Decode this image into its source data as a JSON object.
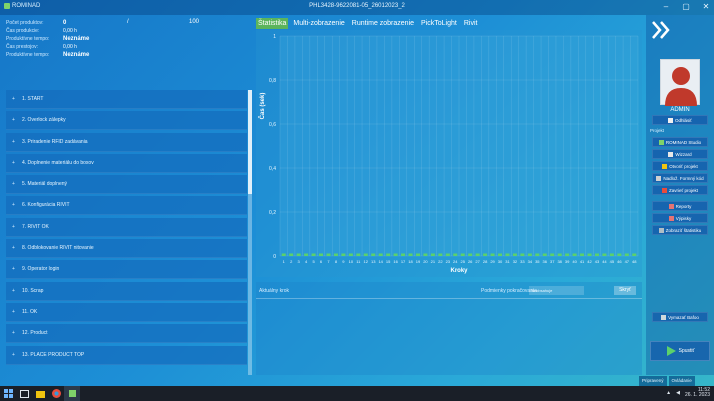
{
  "window": {
    "app_name": "ROMINAD",
    "title": "PHL3428-9622081-05_26012023_2",
    "controls": [
      "–",
      "▢",
      "✕"
    ]
  },
  "stats": [
    {
      "label": "Počet produktov:",
      "value": "0",
      "slash": "/",
      "total": "100"
    },
    {
      "label": "Čas produkcie:",
      "value": "0,00 h"
    },
    {
      "label": "Produktívne tempo:",
      "value": "Neznáme"
    },
    {
      "label": "Čas prestojov:",
      "value": "0,00 h"
    },
    {
      "label": "Produktívne tempo:",
      "value": "Neznáme"
    }
  ],
  "steps": [
    "1. START",
    "2. Overlock zálepky",
    "3. Priradenie RFID zadávania",
    "4. Doplnenie materiálu do boxov",
    "5. Materiál doplnený",
    "6. Konfigurácia RIVIT",
    "7. RIVIT OK",
    "8. Odblokovanie RIVIT nitovanie",
    "9. Operator login",
    "10. Scrap",
    "11. OK",
    "12. Product",
    "13. PLACE PRODUCT TOP"
  ],
  "tabs": [
    "Štatistika",
    "Multi-zobrazenie",
    "Runtime zobrazenie",
    "PickToLight",
    "Rivit"
  ],
  "active_tab": 0,
  "chart_data": {
    "type": "bar",
    "xlabel": "Kroky",
    "ylabel": "Čas (sek)",
    "yticks": [
      "0",
      "0,2",
      "0,4",
      "0,6",
      "0,8",
      "1"
    ],
    "ylim": [
      0,
      1
    ],
    "categories": [
      "1",
      "2",
      "3",
      "4",
      "5",
      "6",
      "7",
      "8",
      "9",
      "10",
      "11",
      "12",
      "13",
      "14",
      "15",
      "16",
      "17",
      "18",
      "19",
      "20",
      "21",
      "22",
      "23",
      "24",
      "25",
      "26",
      "27",
      "28",
      "29",
      "30",
      "31",
      "32",
      "33",
      "34",
      "35",
      "36",
      "37",
      "38",
      "39",
      "40",
      "41",
      "42",
      "43",
      "44",
      "45",
      "46",
      "47",
      "48"
    ],
    "values": [
      0,
      0,
      0,
      0,
      0,
      0,
      0,
      0,
      0,
      0,
      0,
      0,
      0,
      0,
      0,
      0,
      0,
      0,
      0,
      0,
      0,
      0,
      0,
      0,
      0,
      0,
      0,
      0,
      0,
      0,
      0,
      0,
      0,
      0,
      0,
      0,
      0,
      0,
      0,
      0,
      0,
      0,
      0,
      0,
      0,
      0,
      0,
      0
    ],
    "bar_color": "#5bd16b",
    "grid": true
  },
  "lower": {
    "current_step_label": "Aktuálny krok",
    "pp_label": "Podmienky pokračovania",
    "filter_placeholder": "Neobsahuje",
    "hide_button": "Skryť"
  },
  "sidebar": {
    "user": "ADMIN",
    "logout": "Odhlásiť",
    "project_label": "Projekt",
    "project_buttons": [
      "ROMINAD Studio",
      "Wizzard",
      "Otvoriť projekt",
      "Nadlož. Formný kód",
      "Zavrieť projekt"
    ],
    "report_buttons": [
      "Reporty",
      "Výpisky",
      "Zobraziť štatistiku"
    ],
    "extra_button": "Vymazať Bafoo",
    "start_button": "Spustiť"
  },
  "status": [
    "Pripravený",
    "Ovládanie"
  ],
  "taskbar": {
    "time": "11:52",
    "date": "26. 1. 2023"
  }
}
